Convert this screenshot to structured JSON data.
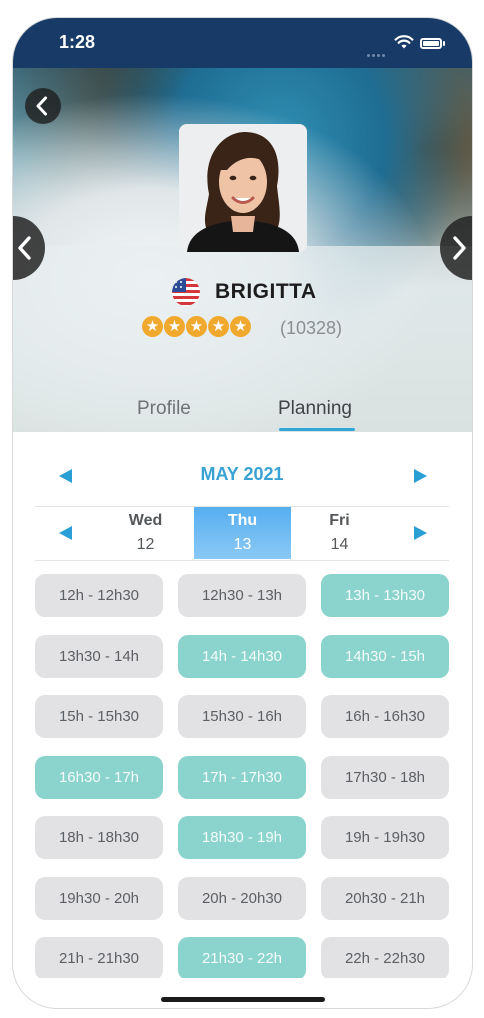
{
  "status_bar": {
    "time": "1:28"
  },
  "profile": {
    "name": "BRIGITTA",
    "rating": 5,
    "review_count": "(10328)",
    "country": "United States"
  },
  "tabs": [
    {
      "label": "Profile",
      "selected": false
    },
    {
      "label": "Planning",
      "selected": true
    }
  ],
  "planning": {
    "month": "MAY 2021",
    "days": [
      {
        "name": "Wed",
        "number": "12",
        "selected": false
      },
      {
        "name": "Thu",
        "number": "13",
        "selected": true
      },
      {
        "name": "Fri",
        "number": "14",
        "selected": false
      }
    ],
    "slots": [
      {
        "label": "12h - 12h30",
        "available": false
      },
      {
        "label": "12h30 - 13h",
        "available": false
      },
      {
        "label": "13h - 13h30",
        "available": true
      },
      {
        "label": "13h30 - 14h",
        "available": false
      },
      {
        "label": "14h - 14h30",
        "available": true
      },
      {
        "label": "14h30 - 15h",
        "available": true
      },
      {
        "label": "15h - 15h30",
        "available": false
      },
      {
        "label": "15h30 - 16h",
        "available": false
      },
      {
        "label": "16h - 16h30",
        "available": false
      },
      {
        "label": "16h30 - 17h",
        "available": true
      },
      {
        "label": "17h - 17h30",
        "available": true
      },
      {
        "label": "17h30 - 18h",
        "available": false
      },
      {
        "label": "18h - 18h30",
        "available": false
      },
      {
        "label": "18h30 - 19h",
        "available": true
      },
      {
        "label": "19h - 19h30",
        "available": false
      },
      {
        "label": "19h30 - 20h",
        "available": false
      },
      {
        "label": "20h - 20h30",
        "available": false
      },
      {
        "label": "20h30 - 21h",
        "available": false
      },
      {
        "label": "21h - 21h30",
        "available": false
      },
      {
        "label": "21h30 - 22h",
        "available": true
      },
      {
        "label": "22h - 22h30",
        "available": false
      }
    ]
  },
  "colors": {
    "status_bar": "#173a66",
    "accent_blue": "#2ea6d8",
    "available_slot": "#8ad4cd",
    "unavailable_slot": "#e2e2e4",
    "star": "#f0a92d"
  },
  "icons": {
    "back": "chevron-left-icon",
    "previous_profile": "chevron-left-icon",
    "next_profile": "chevron-right-icon",
    "previous_month": "triangle-left-icon",
    "next_month": "triangle-right-icon",
    "previous_days": "triangle-left-icon",
    "next_days": "triangle-right-icon",
    "wifi": "wifi-icon",
    "battery": "battery-icon",
    "flag": "us-flag-icon"
  }
}
